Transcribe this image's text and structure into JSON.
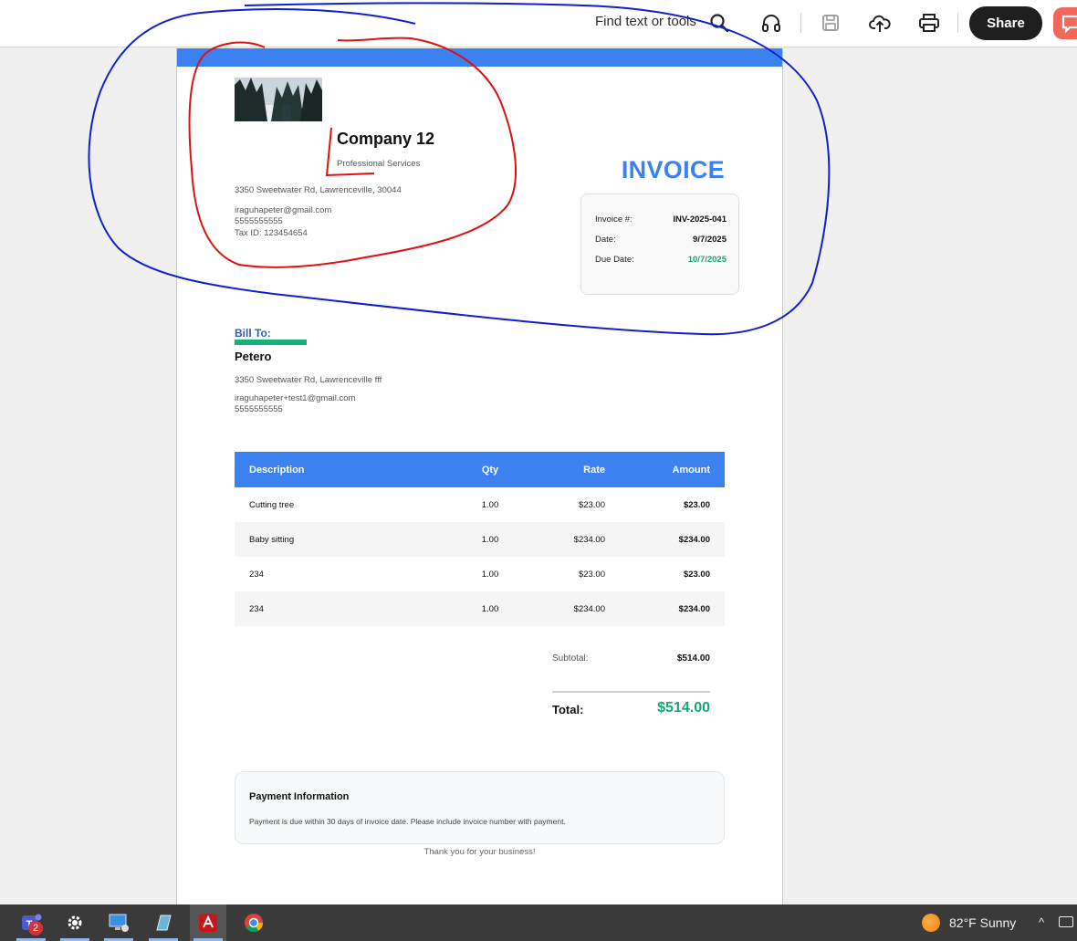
{
  "toolbar": {
    "find_placeholder": "Find text or tools",
    "share_label": "Share",
    "icons": [
      "search-icon",
      "headphones-icon",
      "save-icon",
      "cloud-upload-icon",
      "print-icon",
      "comment-icon"
    ]
  },
  "company": {
    "name": "Company 12",
    "tagline": "Professional Services",
    "address": "3350 Sweetwater Rd, Lawrenceville, 30044",
    "email": "iraguhapeter@gmail.com",
    "phone": "5555555555",
    "tax_id": "Tax ID: 123454654"
  },
  "invoice": {
    "title": "INVOICE",
    "number_label": "Invoice #:",
    "number": "INV-2025-041",
    "date_label": "Date:",
    "date": "9/7/2025",
    "due_label": "Due Date:",
    "due_date": "10/7/2025"
  },
  "bill_to": {
    "label": "Bill To:",
    "name": "Petero",
    "address": "3350 Sweetwater Rd, Lawrenceville fff",
    "email": "iraguhapeter+test1@gmail.com",
    "phone": "5555555555"
  },
  "items": {
    "headers": [
      "Description",
      "Qty",
      "Rate",
      "Amount"
    ],
    "rows": [
      [
        "Cutting tree",
        "1.00",
        "$23.00",
        "$23.00"
      ],
      [
        "Baby sitting",
        "1.00",
        "$234.00",
        "$234.00"
      ],
      [
        "234",
        "1.00",
        "$23.00",
        "$23.00"
      ],
      [
        "234",
        "1.00",
        "$234.00",
        "$234.00"
      ]
    ]
  },
  "totals": {
    "subtotal_label": "Subtotal:",
    "subtotal": "$514.00",
    "total_label": "Total:",
    "total": "$514.00"
  },
  "payment": {
    "title": "Payment Information",
    "text": "Payment is due within 30 days of invoice date. Please include invoice number with payment."
  },
  "footer": {
    "thanks": "Thank you for your business!"
  },
  "colors": {
    "accent": "#3b82f0",
    "success": "#17a870",
    "annotation_red": "#e01010",
    "annotation_blue": "#1020d0"
  },
  "taskbar": {
    "apps": [
      "teams-icon",
      "settings-icon",
      "remote-desktop-icon",
      "notepad-icon",
      "acrobat-icon",
      "chrome-icon"
    ],
    "teams_badge": "2",
    "weather": "82°F  Sunny"
  }
}
